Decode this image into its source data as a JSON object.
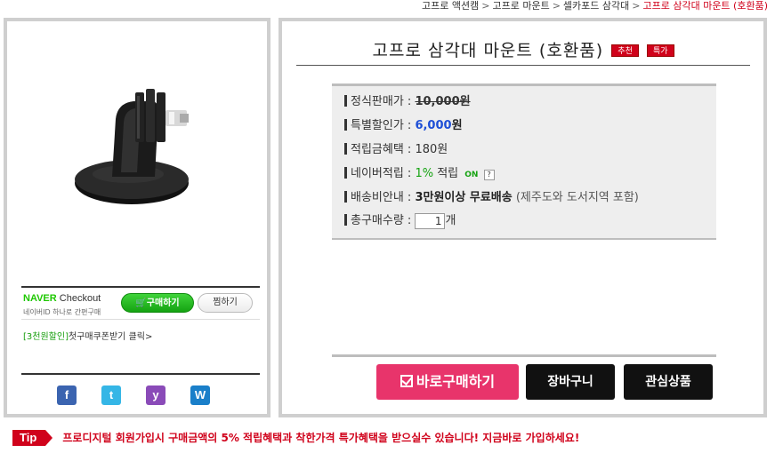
{
  "breadcrumb": {
    "items": [
      "고프로 액션캠",
      "고프로 마운트",
      "셀카포드 삼각대"
    ],
    "current": "고프로 삼각대 마운트 (호환품)",
    "separator": ">"
  },
  "left_panel": {
    "product_image_alt": "black tripod mount",
    "checkout": {
      "naver": "NAVER",
      "checkout": "Checkout",
      "sub": "네이버ID 하나로 간편구매",
      "buy_label": "구매하기",
      "wish_label": "찜하기"
    },
    "coupon": {
      "tag": "[3천원할인]",
      "text": "첫구매쿠폰받기 클릭>"
    },
    "social": [
      {
        "name": "facebook-icon",
        "glyph": "f",
        "color": "#3b64b0"
      },
      {
        "name": "twitter-icon",
        "glyph": "t",
        "color": "#35b6e6"
      },
      {
        "name": "yozm-icon",
        "glyph": "y",
        "color": "#8a4bb8"
      },
      {
        "name": "w-icon",
        "glyph": "W",
        "color": "#1a7fc9"
      }
    ]
  },
  "product": {
    "title": "고프로 삼각대 마운트 (호환품)",
    "badges": [
      "추천",
      "특가"
    ]
  },
  "info": {
    "list_price_label": "정식판매가 :",
    "list_price": "10,000원",
    "sale_price_label": "특별할인가 :",
    "sale_price_value": "6,000",
    "sale_price_unit": "원",
    "points_label": "적립금혜택 :",
    "points": "180원",
    "naver_label": "네이버적립 :",
    "naver_pct": "1%",
    "naver_suffix": "적립",
    "on_text": "ON",
    "help_text": "?",
    "shipping_label": "배송비안내 :",
    "shipping_bold": "3만원이상 무료배송",
    "shipping_note": "(제주도와 도서지역 포함)",
    "qty_label": "총구매수량 :",
    "qty_value": "1",
    "qty_unit": "개"
  },
  "actions": {
    "buy_now": "바로구매하기",
    "cart": "장바구니",
    "wishlist": "관심상품"
  },
  "tip": {
    "badge": "Tip",
    "text": "프로디지털 회원가입시 구매금액의 5% 적립혜택과 착한가격 특가혜택을 받으실수 있습니다! 지금바로 가입하세요!"
  },
  "colors": {
    "accent_red": "#d0021b",
    "buy_pink": "#e8346b",
    "naver_green": "#1ec800",
    "price_blue": "#1e4fd6"
  }
}
